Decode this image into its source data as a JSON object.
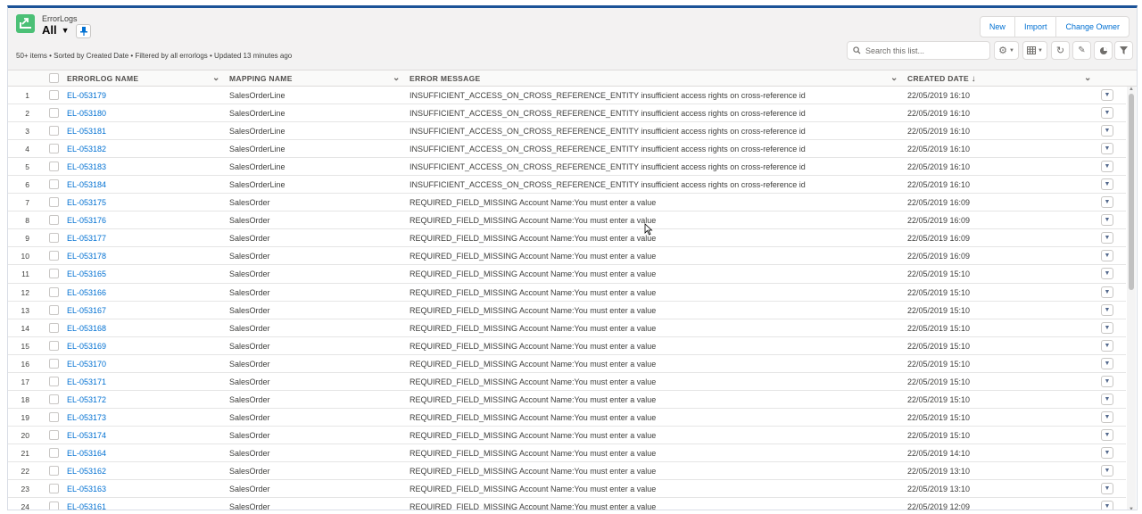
{
  "header": {
    "object_label": "ErrorLogs",
    "list_view": "All",
    "info": "50+ items • Sorted by Created Date • Filtered by all errorlogs • Updated 13 minutes ago",
    "buttons": {
      "new": "New",
      "import": "Import",
      "change_owner": "Change Owner"
    },
    "search_placeholder": "Search this list...",
    "accent_color": "#4bc076"
  },
  "table": {
    "columns": {
      "name": "ERRORLOG NAME",
      "mapping": "MAPPING NAME",
      "error": "ERROR MESSAGE",
      "created": "CREATED DATE"
    },
    "sort_indicator": "↓",
    "rows": [
      {
        "num": "1",
        "name": "EL-053179",
        "mapping": "SalesOrderLine",
        "error": "INSUFFICIENT_ACCESS_ON_CROSS_REFERENCE_ENTITY insufficient access rights on cross-reference id",
        "date": "22/05/2019 16:10"
      },
      {
        "num": "2",
        "name": "EL-053180",
        "mapping": "SalesOrderLine",
        "error": "INSUFFICIENT_ACCESS_ON_CROSS_REFERENCE_ENTITY insufficient access rights on cross-reference id",
        "date": "22/05/2019 16:10"
      },
      {
        "num": "3",
        "name": "EL-053181",
        "mapping": "SalesOrderLine",
        "error": "INSUFFICIENT_ACCESS_ON_CROSS_REFERENCE_ENTITY insufficient access rights on cross-reference id",
        "date": "22/05/2019 16:10"
      },
      {
        "num": "4",
        "name": "EL-053182",
        "mapping": "SalesOrderLine",
        "error": "INSUFFICIENT_ACCESS_ON_CROSS_REFERENCE_ENTITY insufficient access rights on cross-reference id",
        "date": "22/05/2019 16:10"
      },
      {
        "num": "5",
        "name": "EL-053183",
        "mapping": "SalesOrderLine",
        "error": "INSUFFICIENT_ACCESS_ON_CROSS_REFERENCE_ENTITY insufficient access rights on cross-reference id",
        "date": "22/05/2019 16:10"
      },
      {
        "num": "6",
        "name": "EL-053184",
        "mapping": "SalesOrderLine",
        "error": "INSUFFICIENT_ACCESS_ON_CROSS_REFERENCE_ENTITY insufficient access rights on cross-reference id",
        "date": "22/05/2019 16:10"
      },
      {
        "num": "7",
        "name": "EL-053175",
        "mapping": "SalesOrder",
        "error": "REQUIRED_FIELD_MISSING Account Name:You must enter a value",
        "date": "22/05/2019 16:09"
      },
      {
        "num": "8",
        "name": "EL-053176",
        "mapping": "SalesOrder",
        "error": "REQUIRED_FIELD_MISSING Account Name:You must enter a value",
        "date": "22/05/2019 16:09"
      },
      {
        "num": "9",
        "name": "EL-053177",
        "mapping": "SalesOrder",
        "error": "REQUIRED_FIELD_MISSING Account Name:You must enter a value",
        "date": "22/05/2019 16:09"
      },
      {
        "num": "10",
        "name": "EL-053178",
        "mapping": "SalesOrder",
        "error": "REQUIRED_FIELD_MISSING Account Name:You must enter a value",
        "date": "22/05/2019 16:09"
      },
      {
        "num": "11",
        "name": "EL-053165",
        "mapping": "SalesOrder",
        "error": "REQUIRED_FIELD_MISSING Account Name:You must enter a value",
        "date": "22/05/2019 15:10"
      },
      {
        "num": "12",
        "name": "EL-053166",
        "mapping": "SalesOrder",
        "error": "REQUIRED_FIELD_MISSING Account Name:You must enter a value",
        "date": "22/05/2019 15:10"
      },
      {
        "num": "13",
        "name": "EL-053167",
        "mapping": "SalesOrder",
        "error": "REQUIRED_FIELD_MISSING Account Name:You must enter a value",
        "date": "22/05/2019 15:10"
      },
      {
        "num": "14",
        "name": "EL-053168",
        "mapping": "SalesOrder",
        "error": "REQUIRED_FIELD_MISSING Account Name:You must enter a value",
        "date": "22/05/2019 15:10"
      },
      {
        "num": "15",
        "name": "EL-053169",
        "mapping": "SalesOrder",
        "error": "REQUIRED_FIELD_MISSING Account Name:You must enter a value",
        "date": "22/05/2019 15:10"
      },
      {
        "num": "16",
        "name": "EL-053170",
        "mapping": "SalesOrder",
        "error": "REQUIRED_FIELD_MISSING Account Name:You must enter a value",
        "date": "22/05/2019 15:10"
      },
      {
        "num": "17",
        "name": "EL-053171",
        "mapping": "SalesOrder",
        "error": "REQUIRED_FIELD_MISSING Account Name:You must enter a value",
        "date": "22/05/2019 15:10"
      },
      {
        "num": "18",
        "name": "EL-053172",
        "mapping": "SalesOrder",
        "error": "REQUIRED_FIELD_MISSING Account Name:You must enter a value",
        "date": "22/05/2019 15:10"
      },
      {
        "num": "19",
        "name": "EL-053173",
        "mapping": "SalesOrder",
        "error": "REQUIRED_FIELD_MISSING Account Name:You must enter a value",
        "date": "22/05/2019 15:10"
      },
      {
        "num": "20",
        "name": "EL-053174",
        "mapping": "SalesOrder",
        "error": "REQUIRED_FIELD_MISSING Account Name:You must enter a value",
        "date": "22/05/2019 15:10"
      },
      {
        "num": "21",
        "name": "EL-053164",
        "mapping": "SalesOrder",
        "error": "REQUIRED_FIELD_MISSING Account Name:You must enter a value",
        "date": "22/05/2019 14:10"
      },
      {
        "num": "22",
        "name": "EL-053162",
        "mapping": "SalesOrder",
        "error": "REQUIRED_FIELD_MISSING Account Name:You must enter a value",
        "date": "22/05/2019 13:10"
      },
      {
        "num": "23",
        "name": "EL-053163",
        "mapping": "SalesOrder",
        "error": "REQUIRED_FIELD_MISSING Account Name:You must enter a value",
        "date": "22/05/2019 13:10"
      },
      {
        "num": "24",
        "name": "EL-053161",
        "mapping": "SalesOrder",
        "error": "REQUIRED_FIELD_MISSING Account Name:You must enter a value",
        "date": "22/05/2019 12:09"
      }
    ]
  }
}
